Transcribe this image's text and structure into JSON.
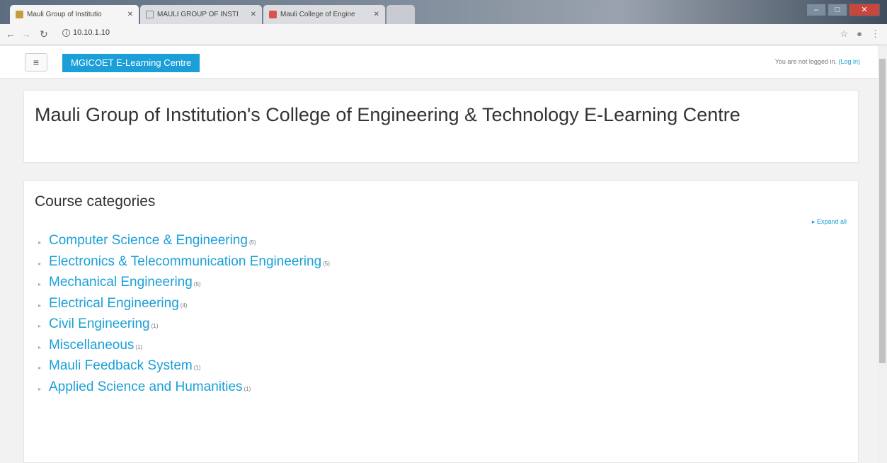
{
  "browser": {
    "tabs": [
      {
        "title": "Mauli Group of Institutio"
      },
      {
        "title": "MAULI GROUP OF INSTI"
      },
      {
        "title": "Mauli College of Engine"
      }
    ],
    "url": "10.10.1.10"
  },
  "navbar": {
    "brand": "MGICOET E-Learning Centre",
    "login_text": "You are not logged in.",
    "login_link": "(Log in)"
  },
  "header": {
    "title": "Mauli Group of Institution's College of Engineering & Technology E-Learning Centre"
  },
  "categories": {
    "heading": "Course categories",
    "expand_all": "Expand all",
    "items": [
      {
        "name": "Computer Science & Engineering",
        "count": "(5)"
      },
      {
        "name": "Electronics & Telecommunication Engineering",
        "count": "(5)"
      },
      {
        "name": "Mechanical Engineering",
        "count": "(5)"
      },
      {
        "name": "Electrical Engineering",
        "count": "(4)"
      },
      {
        "name": "Civil Engineering",
        "count": "(1)"
      },
      {
        "name": "Miscellaneous",
        "count": "(1)"
      },
      {
        "name": "Mauli Feedback System",
        "count": "(1)"
      },
      {
        "name": "Applied Science and Humanities",
        "count": "(1)"
      }
    ]
  },
  "colors": {
    "accent": "#1a9fd8",
    "page_bg": "#f2f2f2"
  }
}
